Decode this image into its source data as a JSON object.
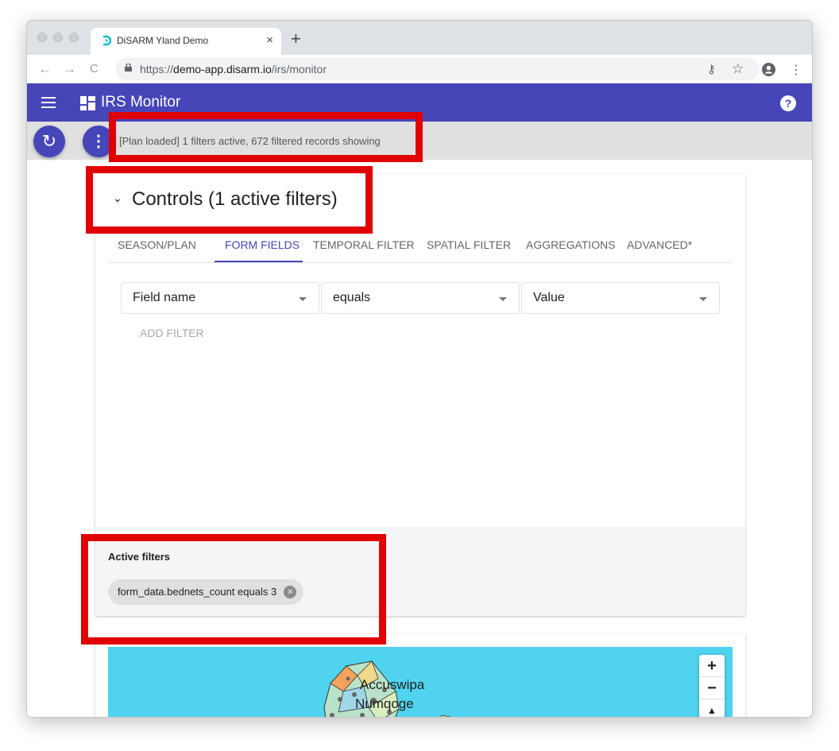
{
  "browser": {
    "tab_title": "DiSARM Yland Demo",
    "tab_close": "×",
    "new_tab": "+",
    "back": "←",
    "forward": "→",
    "reload": "C",
    "url_scheme": "https://",
    "url_host": "demo-app.disarm.io",
    "url_path": "/irs/monitor",
    "key_icon": "⚷",
    "star_icon": "☆",
    "menu_icon": "⋮"
  },
  "appbar": {
    "title": "IRS Monitor",
    "help": "?"
  },
  "statusbar": {
    "refresh_icon": "↻",
    "more_icon": "⋮",
    "text": "[Plan loaded] 1 filters active, 672 filtered records showing"
  },
  "controls": {
    "chevron": "⌄",
    "title": "Controls (1 active filters)",
    "tabs": [
      "SEASON/PLAN",
      "FORM FIELDS",
      "TEMPORAL FILTER",
      "SPATIAL FILTER",
      "AGGREGATIONS",
      "ADVANCED*"
    ],
    "active_tab": "FORM FIELDS",
    "field_select": "Field name",
    "operator_select": "equals",
    "value_select": "Value",
    "add_filter": "ADD FILTER"
  },
  "active_filters": {
    "title": "Active filters",
    "chips": [
      "form_data.bednets_count equals 3"
    ],
    "chip_remove": "×"
  },
  "map": {
    "labels": [
      "Accuswipa",
      "Numqoge"
    ],
    "zoom_in": "+",
    "zoom_out": "−",
    "north": "▲"
  },
  "colors": {
    "primary": "#4646b8",
    "annotation": "#e10000",
    "map_water": "#4fd3ee"
  }
}
